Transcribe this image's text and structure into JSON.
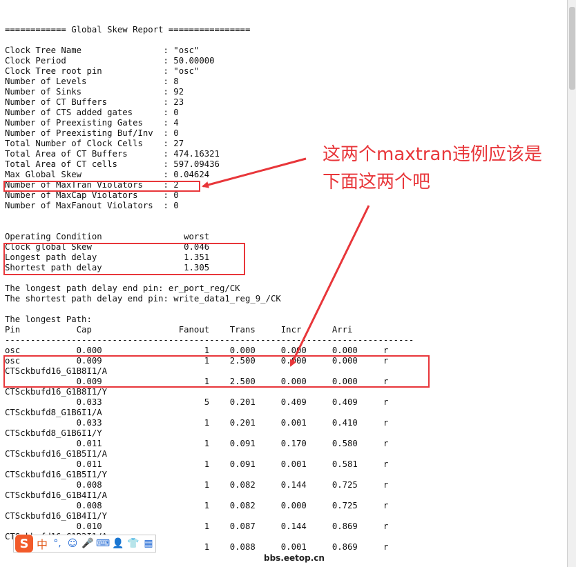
{
  "report": {
    "lines": [
      "************************************************",
      "",
      "",
      "============ Global Skew Report ================",
      "",
      "Clock Tree Name                : \"osc\"",
      "Clock Period                   : 50.00000",
      "Clock Tree root pin            : \"osc\"",
      "Number of Levels               : 8",
      "Number of Sinks                : 92",
      "Number of CT Buffers           : 23",
      "Number of CTS added gates      : 0",
      "Number of Preexisting Gates    : 4",
      "Number of Preexisting Buf/Inv  : 0",
      "Total Number of Clock Cells    : 27",
      "Total Area of CT Buffers       : 474.16321",
      "Total Area of CT cells         : 597.09436",
      "Max Global Skew                : 0.04624",
      "Number of MaxTran Violators    : 2",
      "Number of MaxCap Violators     : 0",
      "Number of MaxFanout Violators  : 0",
      "",
      "",
      "Operating Condition                worst",
      "Clock global Skew                  0.046",
      "Longest path delay                 1.351",
      "Shortest path delay                1.305",
      "",
      "The longest path delay end pin: er_port_reg/CK",
      "The shortest path delay end pin: write_data1_reg_9_/CK",
      "",
      "The longest Path:",
      "Pin           Cap                 Fanout    Trans     Incr      Arri",
      "--------------------------------------------------------------------------------",
      "osc           0.000                    1    0.000     0.000     0.000     r",
      "osc           0.009                    1    2.500     0.000     0.000     r",
      "CTSckbufd16_G1B8I1/A",
      "              0.009                    1    2.500     0.000     0.000     r",
      "CTSckbufd16_G1B8I1/Y",
      "              0.033                    5    0.201     0.409     0.409     r",
      "CTSckbufd8_G1B6I1/A",
      "              0.033                    1    0.201     0.001     0.410     r",
      "CTSckbufd8_G1B6I1/Y",
      "              0.011                    1    0.091     0.170     0.580     r",
      "CTSckbufd16_G1B5I1/A",
      "              0.011                    1    0.091     0.001     0.581     r",
      "CTSckbufd16_G1B5I1/Y",
      "              0.008                    1    0.082     0.144     0.725     r",
      "CTSckbufd16_G1B4I1/A",
      "              0.008                    1    0.082     0.000     0.725     r",
      "CTSckbufd16_G1B4I1/Y",
      "              0.010                    1    0.087     0.144     0.869     r",
      "CTSckbufd16_G1B3I1/A",
      "              0.010                    1    0.088     0.001     0.869     r"
    ]
  },
  "annotation": {
    "line1": "这两个maxtran违例应该是",
    "line2": "下面这两个吧"
  },
  "ime": {
    "logo": "S",
    "mode": "中",
    "punct": "°,",
    "emoji": "☺",
    "voice": "🎤",
    "keyboard": "⌨",
    "user": "👤",
    "skin": "👕",
    "grid": "▦"
  },
  "watermark": "bbs.eetop.cn",
  "colors": {
    "annotation": "#e8363a",
    "ime_logo": "#f25a2a"
  }
}
